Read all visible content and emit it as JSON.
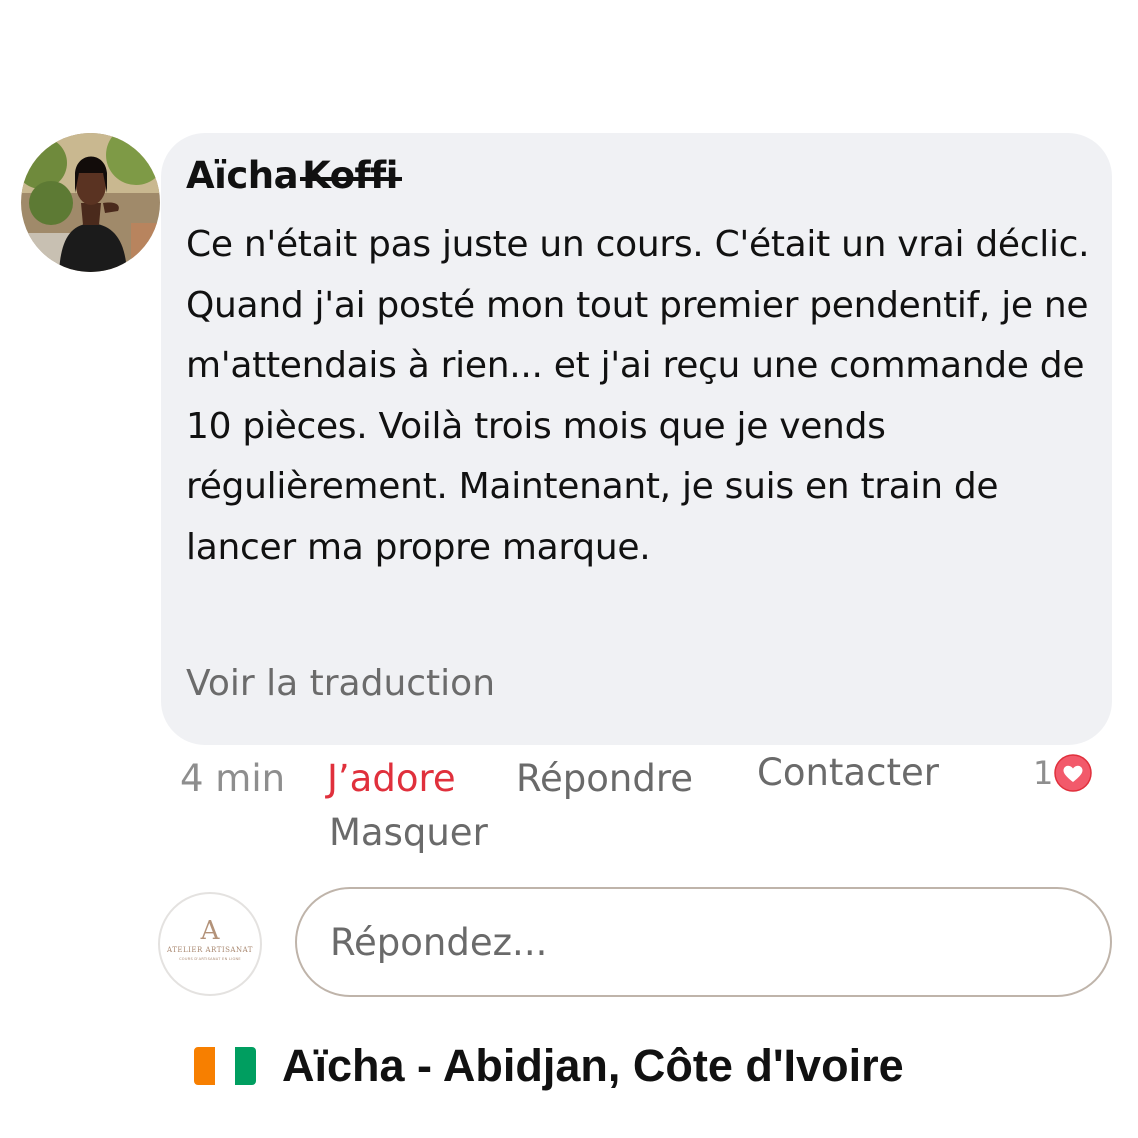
{
  "comment": {
    "author_first_name": "Aïcha",
    "author_last_name_struck": "Koffi",
    "text": "Ce n'était pas juste un cours. C'était un vrai déclic. Quand j'ai posté mon tout premier pendentif, je ne m'attendais à rien... et j'ai reçu une commande de 10 pièces. Voilà trois mois que je vends régulièrement. Maintenant, je suis en train de lancer ma propre marque.",
    "translate_link": "Voir la traduction",
    "avatar_icon": "user-photo-avatar"
  },
  "actions": {
    "time": "4 min",
    "love": "J’adore",
    "reply": "Répondre",
    "contact": "Contacter",
    "hide": "Masquer",
    "reaction_count": "1",
    "reaction_icon": "heart-reaction-icon"
  },
  "reply_box": {
    "placeholder": "Répondez...",
    "brand_mark": "A",
    "brand_name": "ATELIER ARTISANAT",
    "brand_tagline": "COURS D'ARTISANAT EN LIGNE"
  },
  "caption": {
    "text": "Aïcha - Abidjan, Côte d'Ivoire",
    "flag_colors": [
      "#f77f00",
      "#ffffff",
      "#009e60"
    ]
  },
  "colors": {
    "bubble": "#f0f1f4",
    "love_active": "#e0303c",
    "muted_text": "#6a6a6a"
  }
}
